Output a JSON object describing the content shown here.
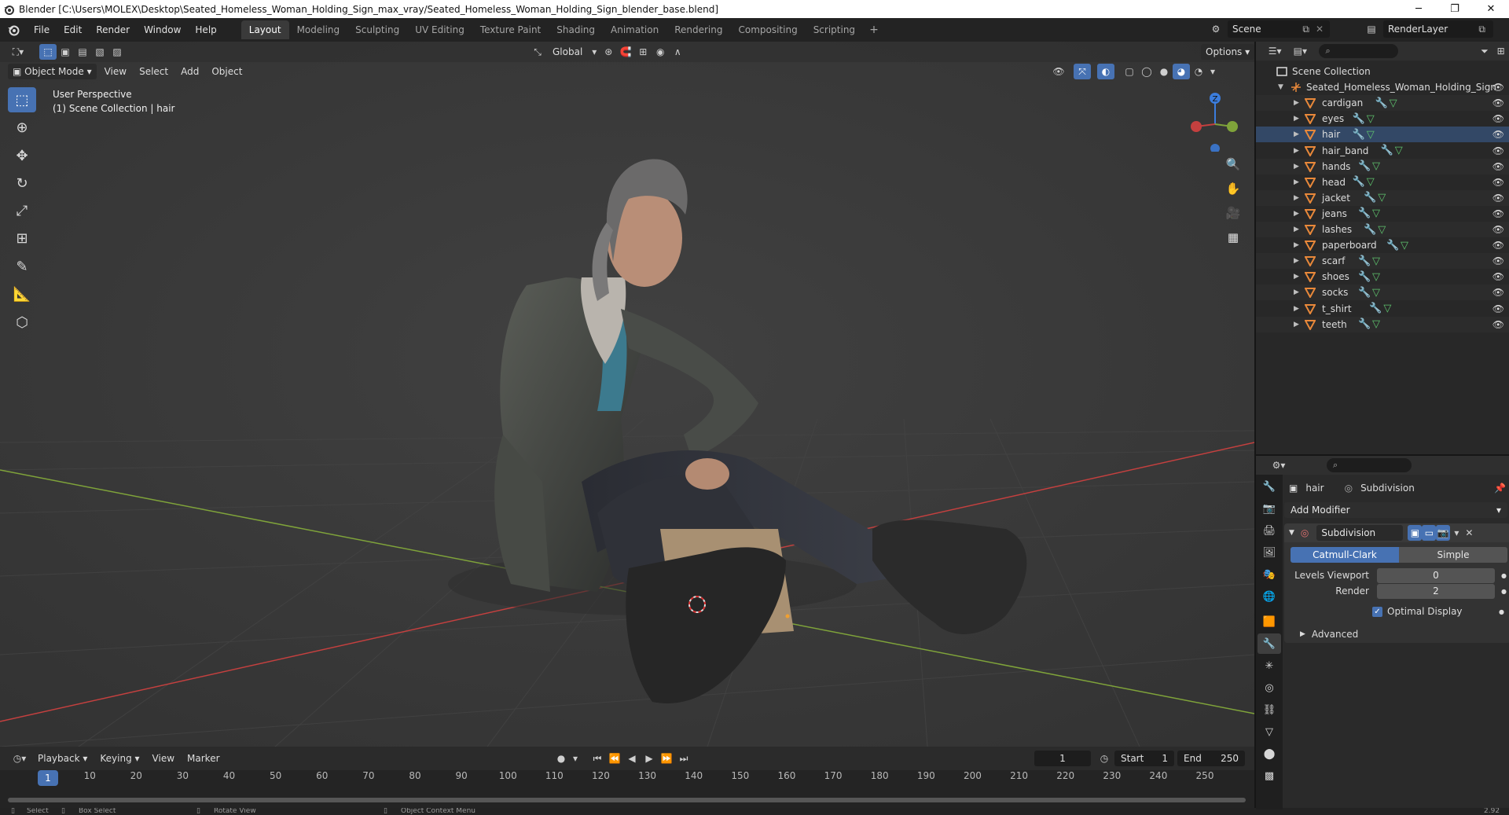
{
  "window": {
    "title": "Blender [C:\\Users\\MOLEX\\Desktop\\Seated_Homeless_Woman_Holding_Sign_max_vray/Seated_Homeless_Woman_Holding_Sign_blender_base.blend]",
    "minimize": "─",
    "maximize": "❐",
    "close": "✕"
  },
  "menu": [
    "File",
    "Edit",
    "Render",
    "Window",
    "Help"
  ],
  "workspaces": [
    "Layout",
    "Modeling",
    "Sculpting",
    "UV Editing",
    "Texture Paint",
    "Shading",
    "Animation",
    "Rendering",
    "Compositing",
    "Scripting"
  ],
  "active_workspace": "Layout",
  "workspace_add": "+",
  "scene": {
    "name": "Scene",
    "render_layer": "RenderLayer"
  },
  "viewport": {
    "transform_orientation": "Global",
    "options_label": "Options",
    "mode": "Object Mode",
    "header_menus": [
      "View",
      "Select",
      "Add",
      "Object"
    ],
    "info_line1": "User Perspective",
    "info_line2": "(1) Scene Collection | hair",
    "gizmo_z": "Z"
  },
  "outliner": {
    "root": "Scene Collection",
    "collection": "Seated_Homeless_Woman_Holding_Sign",
    "objects": [
      "cardigan",
      "eyes",
      "hair",
      "hair_band",
      "hands",
      "head",
      "jacket",
      "jeans",
      "lashes",
      "paperboard",
      "scarf",
      "shoes",
      "socks",
      "t_shirt",
      "teeth"
    ],
    "selected": "hair"
  },
  "properties": {
    "object_name": "hair",
    "modifier_breadcrumb": "Subdivision",
    "add_modifier": "Add Modifier",
    "modifier_name": "Subdivision",
    "algorithm_options": [
      "Catmull-Clark",
      "Simple"
    ],
    "active_algorithm": "Catmull-Clark",
    "levels_viewport_label": "Levels Viewport",
    "levels_viewport": "0",
    "render_label": "Render",
    "render_levels": "2",
    "optimal_display_label": "Optimal Display",
    "advanced_label": "Advanced"
  },
  "timeline": {
    "menus": [
      "Playback",
      "Keying",
      "View",
      "Marker"
    ],
    "current_frame": "1",
    "start_label": "Start",
    "start": "1",
    "end_label": "End",
    "end": "250",
    "ticks": [
      "1",
      "10",
      "20",
      "30",
      "40",
      "50",
      "60",
      "70",
      "80",
      "90",
      "100",
      "110",
      "120",
      "130",
      "140",
      "150",
      "160",
      "170",
      "180",
      "190",
      "200",
      "210",
      "220",
      "230",
      "240",
      "250"
    ]
  },
  "statusbar": {
    "select": "Select",
    "box_select": "Box Select",
    "rotate_view": "Rotate View",
    "context_menu": "Object Context Menu",
    "version": "2.92"
  },
  "colors": {
    "accent": "#4772b3",
    "viewport_bg": "#3a3a3a",
    "x_axis": "#c4403f",
    "y_axis": "#7fa33a",
    "z_axis": "#3b7ddd"
  }
}
